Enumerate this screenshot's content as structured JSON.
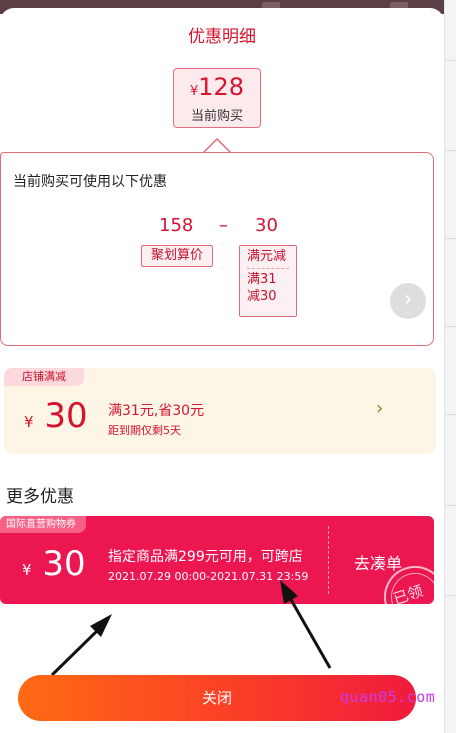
{
  "sheet": {
    "title": "优惠明细"
  },
  "current_price": {
    "currency": "¥",
    "amount": "128",
    "label": "当前购买"
  },
  "detail": {
    "heading": "当前购买可使用以下优惠",
    "base_amount": "158",
    "operator": "–",
    "discount_amount": "30",
    "base_label": "聚划算价",
    "discount_label": "满元减",
    "discount_rule_1": "满31",
    "discount_rule_2": "减30",
    "next_icon": "chevron-right-icon"
  },
  "store_discount": {
    "tag": "店铺满减",
    "currency": "¥",
    "amount": "30",
    "condition": "满31元,省30元",
    "expiry": "距到期仅剩5天",
    "arrow_icon": "chevron-right-icon"
  },
  "more": {
    "title": "更多优惠",
    "coupon": {
      "tag": "国际直营购物券",
      "currency": "¥",
      "amount": "30",
      "condition": "指定商品满299元可用，可跨店",
      "validity": "2021.07.29 00:00-2021.07.31 23:59",
      "action": "去凑单",
      "stamp": "已领"
    }
  },
  "footer": {
    "close_label": "关闭"
  },
  "watermark": "quan05.com",
  "colors": {
    "accent": "#d7122f",
    "coupon_bg": "#ec1650",
    "store_bg": "#fdf6e6"
  }
}
